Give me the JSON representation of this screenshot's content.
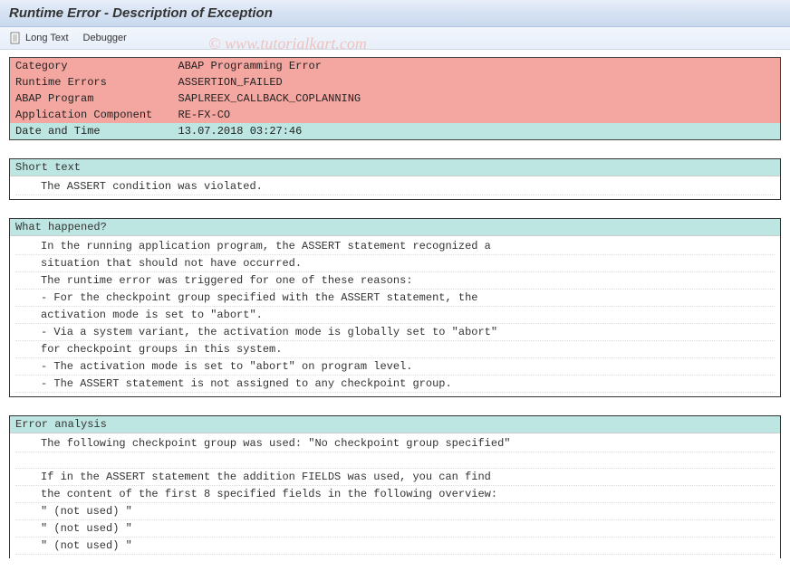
{
  "window": {
    "title": "Runtime Error - Description of Exception"
  },
  "toolbar": {
    "long_text_label": "Long Text",
    "debugger_label": "Debugger"
  },
  "error_info": {
    "rows": [
      {
        "label": "Category",
        "value": "ABAP Programming Error"
      },
      {
        "label": "Runtime Errors",
        "value": "ASSERTION_FAILED"
      },
      {
        "label": "ABAP Program",
        "value": "SAPLREEX_CALLBACK_COPLANNING"
      },
      {
        "label": "Application Component",
        "value": "RE-FX-CO"
      },
      {
        "label": "Date and Time",
        "value": "13.07.2018 03:27:46"
      }
    ]
  },
  "sections": {
    "short_text": {
      "header": "Short text",
      "lines": [
        "The ASSERT condition was violated."
      ]
    },
    "what_happened": {
      "header": "What happened?",
      "lines": [
        "In the running application program, the ASSERT statement recognized a",
        "situation that should not have occurred.",
        "The runtime error was triggered for one of these reasons:",
        "- For the checkpoint group specified with the ASSERT statement, the",
        "  activation mode is set to \"abort\".",
        "- Via a system variant, the activation mode is globally set to \"abort\"",
        "  for checkpoint groups in this system.",
        "- The activation mode is set to \"abort\" on program level.",
        "- The ASSERT statement is not assigned to any checkpoint group."
      ]
    },
    "error_analysis": {
      "header": "Error analysis",
      "lines": [
        "The following checkpoint group was used: \"No checkpoint group specified\"",
        "",
        "If in the ASSERT statement the addition FIELDS was used, you can find",
        "the content of the first 8 specified fields in the following overview:",
        "\" (not used) \"",
        "\" (not used) \"",
        "\" (not used) \""
      ]
    }
  },
  "watermark": "© www.tutorialkart.com"
}
